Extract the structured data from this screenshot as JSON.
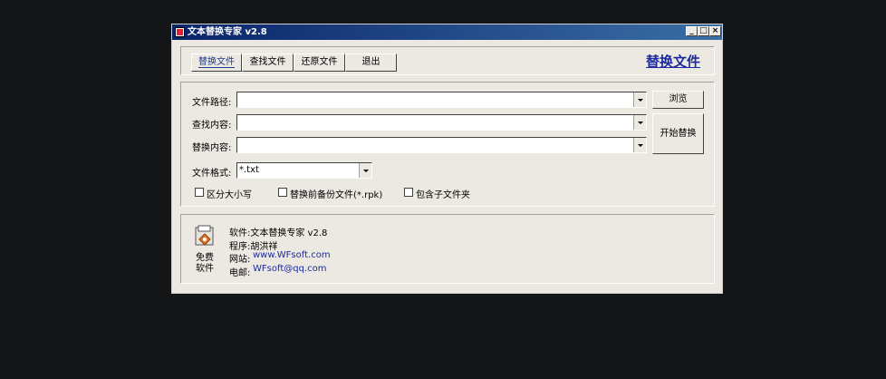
{
  "window": {
    "title": "文本替换专家 v2.8",
    "minimize": "_",
    "maximize": "□",
    "close": "×"
  },
  "tabs": [
    {
      "label": "替换文件",
      "active": true
    },
    {
      "label": "查找文件",
      "active": false
    },
    {
      "label": "还原文件",
      "active": false
    },
    {
      "label": "退出",
      "active": false
    }
  ],
  "heading": "替换文件",
  "form": {
    "path_label": "文件路径:",
    "path_value": "",
    "find_label": "查找内容:",
    "find_value": "",
    "replace_label": "替换内容:",
    "replace_value": "",
    "format_label": "文件格式:",
    "format_value": "*.txt"
  },
  "buttons": {
    "browse": "浏览",
    "start": "开始替换"
  },
  "options": [
    {
      "label": "区分大小写",
      "checked": false
    },
    {
      "label": "替换前备份文件(*.rpk)",
      "checked": false
    },
    {
      "label": "包含子文件夹",
      "checked": false
    }
  ],
  "about": {
    "badge": "免费\n软件",
    "software": "软件:文本替换专家 v2.8",
    "author": "程序:胡洪祥",
    "website_label": "网站:",
    "website": "www.WFsoft.com",
    "email_label": "电邮:",
    "email": "WFsoft@qq.com"
  },
  "colors": {
    "heading": "#1c2aa0",
    "link": "#1c2aa0",
    "titlebar": "#0a246a"
  }
}
